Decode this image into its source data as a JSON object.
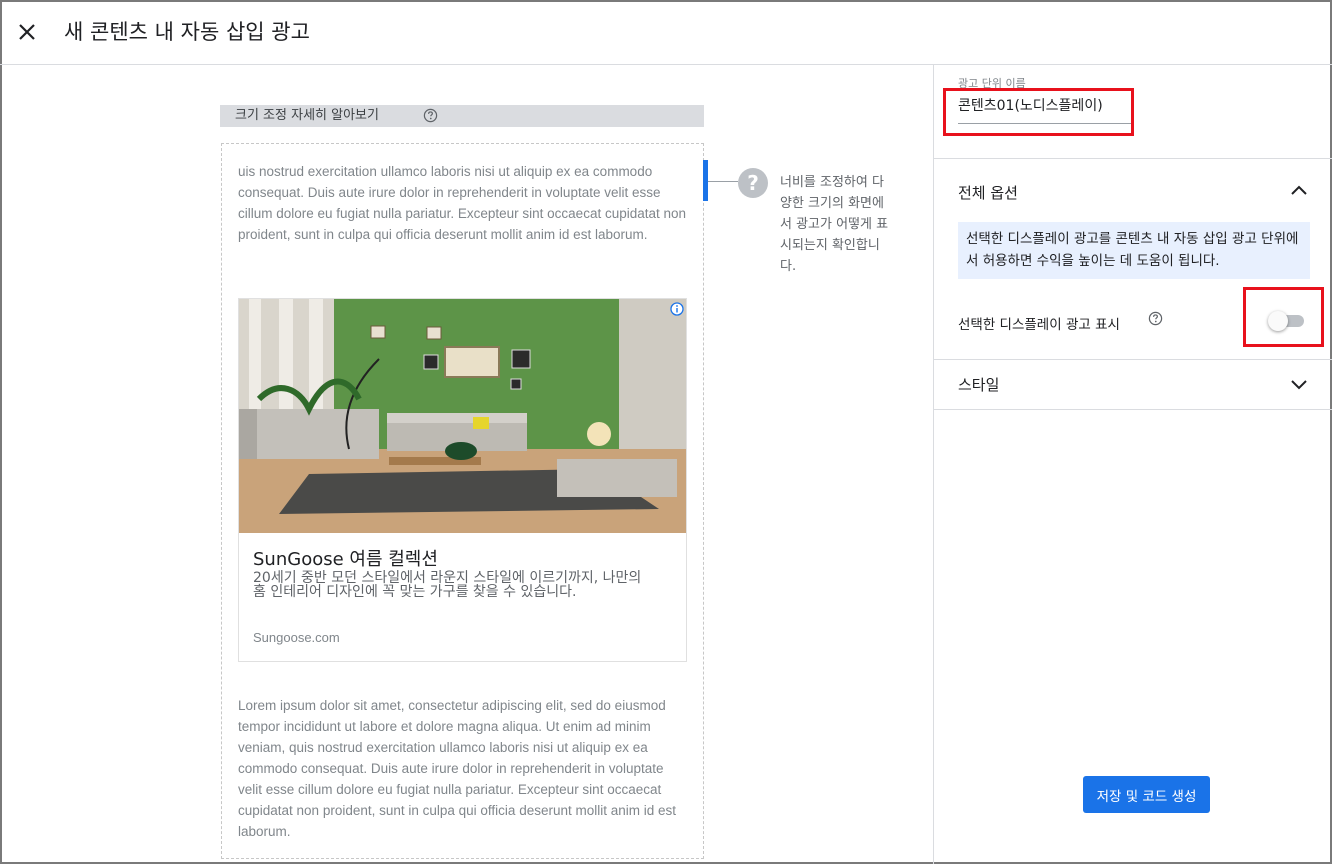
{
  "header": {
    "title": "새 콘텐츠 내 자동 삽입 광고"
  },
  "preview": {
    "resize_label": "크기 조정 자세히 알아보기",
    "lorem_top": "uis nostrud exercitation ullamco laboris nisi ut aliquip ex ea commodo consequat. Duis aute irure dolor in reprehenderit in voluptate velit esse cillum dolore eu fugiat nulla pariatur. Excepteur sint occaecat cupidatat non proident, sunt in culpa qui officia deserunt mollit anim id est laborum.",
    "ad": {
      "title": "SunGoose 여름 컬렉션",
      "description": "20세기 중반 모던 스타일에서 라운지 스타일에 이르기까지, 나만의 홈 인테리어 디자인에 꼭 맞는 가구를 찾을 수 있습니다.",
      "url": "Sungoose.com"
    },
    "lorem_bottom": "Lorem ipsum dolor sit amet, consectetur adipiscing elit, sed do eiusmod tempor incididunt ut labore et dolore magna aliqua. Ut enim ad minim veniam, quis nostrud exercitation ullamco laboris nisi ut aliquip ex ea commodo consequat. Duis aute irure dolor in reprehenderit in voluptate velit esse cillum dolore eu fugiat nulla pariatur. Excepteur sint occaecat cupidatat non proident, sunt in culpa qui officia deserunt mollit anim id est laborum.",
    "hint": "너비를 조정하여 다양한 크기의 화면에서 광고가 어떻게 표시되는지 확인합니다."
  },
  "panel": {
    "ad_unit_name_label": "광고 단위 이름",
    "ad_unit_name_value": "콘텐츠01(노디스플레이)",
    "general_options_title": "전체 옵션",
    "info_text": "선택한 디스플레이 광고를 콘텐츠 내 자동 삽입 광고 단위에서 허용하면 수익을 높이는 데 도움이 됩니다.",
    "toggle_label": "선택한 디스플레이 광고 표시",
    "toggle_on": false,
    "style_title": "스타일",
    "save_label": "저장 및 코드 생성"
  },
  "colors": {
    "accent": "#1a73e8",
    "highlight": "#e8111c",
    "info_bg": "#e8f0fe"
  },
  "icons": [
    "close-icon",
    "help-icon",
    "question-icon",
    "info-icon",
    "chevron-up-icon",
    "chevron-down-icon"
  ]
}
